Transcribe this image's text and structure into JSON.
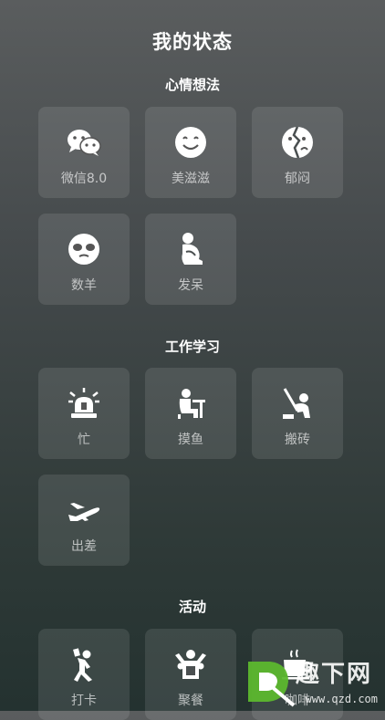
{
  "page": {
    "title": "我的状态"
  },
  "sections": [
    {
      "title": "心情想法",
      "items": [
        {
          "label": "微信8.0",
          "icon": "chat-bubbles-icon"
        },
        {
          "label": "美滋滋",
          "icon": "smile-icon"
        },
        {
          "label": "郁闷",
          "icon": "gloomy-face-icon"
        },
        {
          "label": "数羊",
          "icon": "sheep-face-icon"
        },
        {
          "label": "发呆",
          "icon": "daydream-person-icon"
        }
      ]
    },
    {
      "title": "工作学习",
      "items": [
        {
          "label": "忙",
          "icon": "alarm-siren-icon"
        },
        {
          "label": "摸鱼",
          "icon": "person-at-desk-icon"
        },
        {
          "label": "搬砖",
          "icon": "shovel-worker-icon"
        },
        {
          "label": "出差",
          "icon": "airplane-icon"
        }
      ]
    },
    {
      "title": "活动",
      "items": [
        {
          "label": "打卡",
          "icon": "running-person-icon"
        },
        {
          "label": "聚餐",
          "icon": "group-cheer-icon"
        },
        {
          "label": "咖啡",
          "icon": "coffee-cup-icon"
        }
      ]
    }
  ],
  "watermark": {
    "text": "趣下网",
    "url": "www.qzd.com"
  }
}
